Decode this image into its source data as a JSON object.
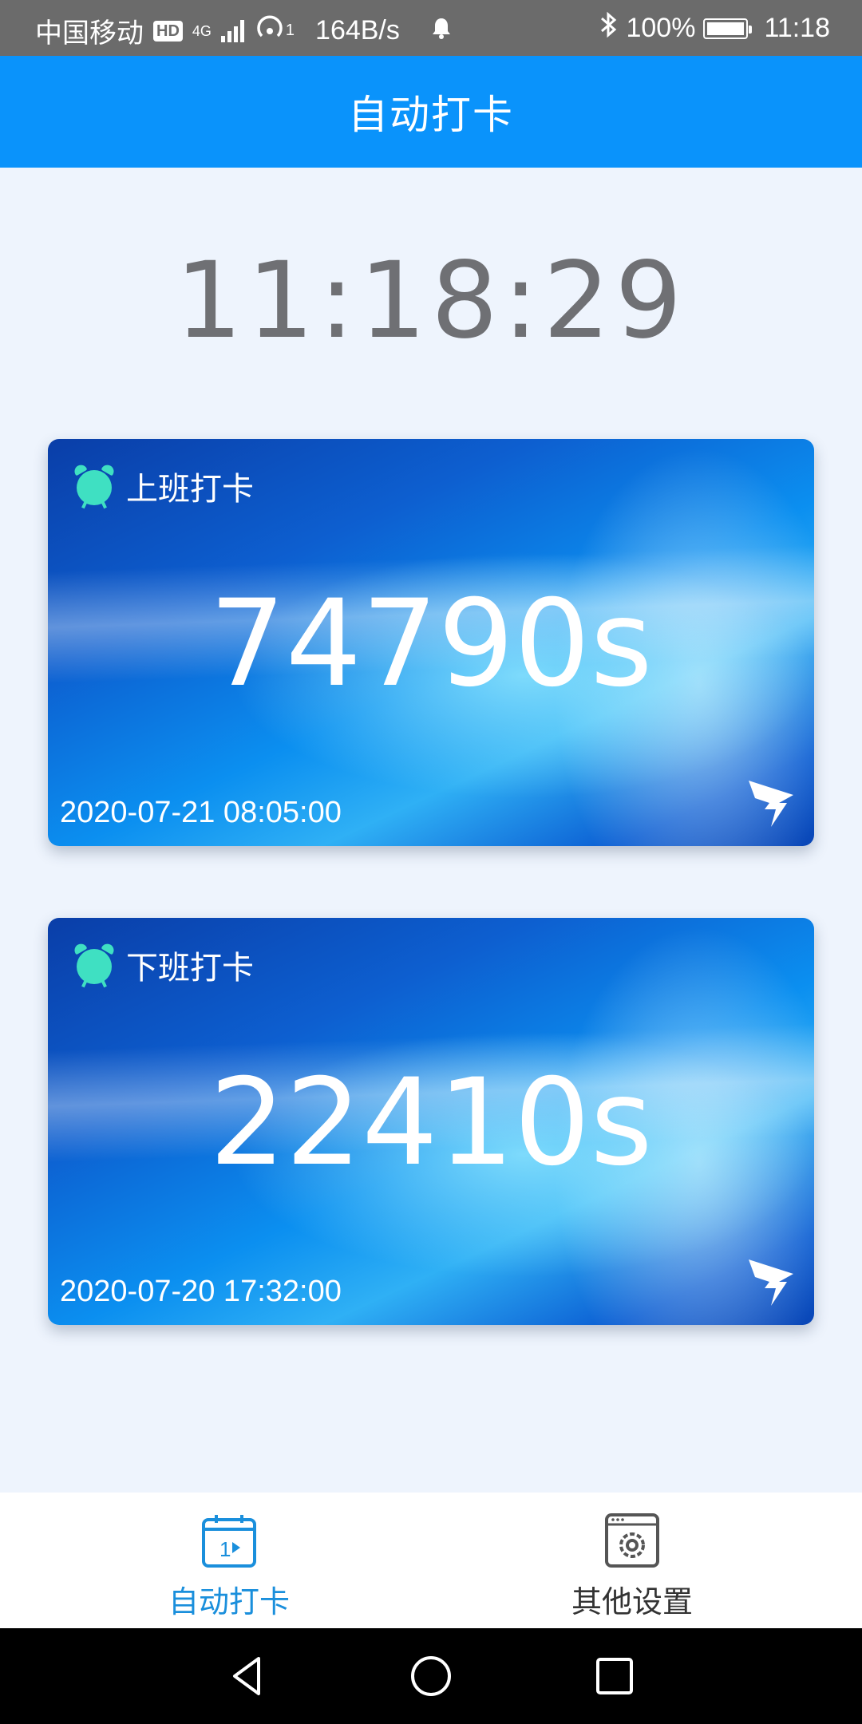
{
  "status_bar": {
    "carrier": "中国移动",
    "hd": "HD",
    "network_type": "4G",
    "hotspot_sup": "1",
    "speed": "164B/s",
    "bluetooth": "bluetooth-icon",
    "battery_percent": "100%",
    "time": "11:18"
  },
  "app_bar": {
    "title": "自动打卡"
  },
  "clock": {
    "time": "11:18:29"
  },
  "cards": [
    {
      "label": "上班打卡",
      "countdown": "74790s",
      "datetime": "2020-07-21 08:05:00",
      "icon": "alarm-clock-icon",
      "brand_icon": "dingtalk-logo-icon"
    },
    {
      "label": "下班打卡",
      "countdown": "22410s",
      "datetime": "2020-07-20 17:32:00",
      "icon": "alarm-clock-icon",
      "brand_icon": "dingtalk-logo-icon"
    }
  ],
  "bottom_nav": {
    "items": [
      {
        "label": "自动打卡",
        "icon": "calendar-icon",
        "active": true
      },
      {
        "label": "其他设置",
        "icon": "settings-window-icon",
        "active": false
      }
    ]
  },
  "colors": {
    "primary": "#0a93fb",
    "active_nav": "#1a8fdc",
    "alarm_icon": "#3fe0c2",
    "clock_text": "#6f7074",
    "background": "#eef4fd"
  }
}
